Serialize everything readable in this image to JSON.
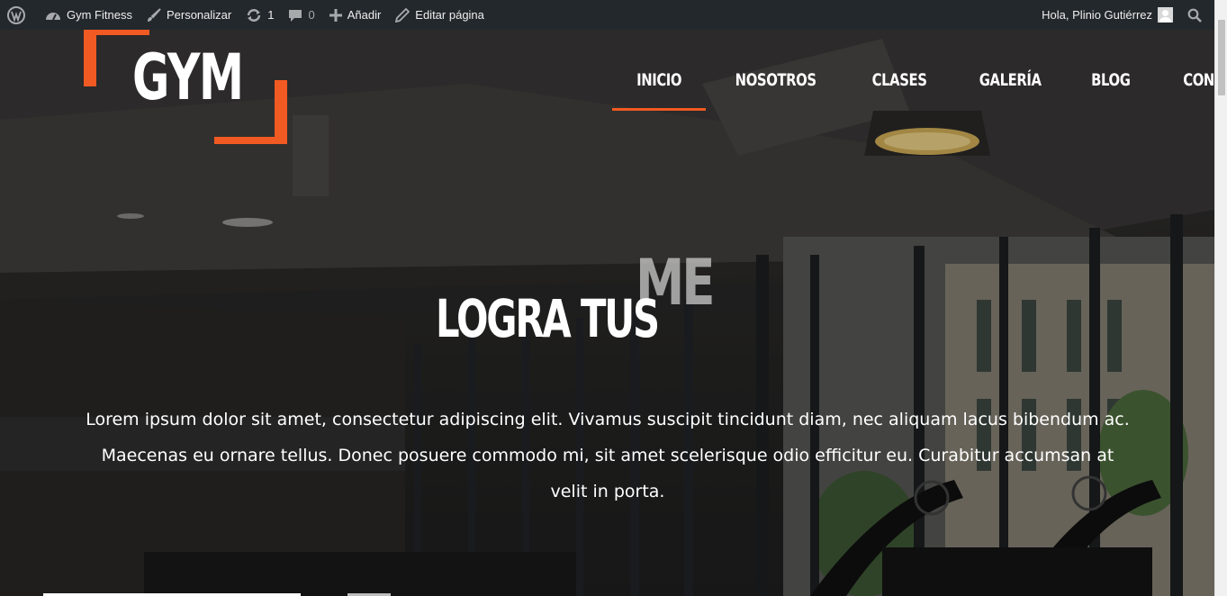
{
  "adminbar": {
    "site_name": "Gym Fitness",
    "customize": "Personalizar",
    "updates_count": "1",
    "comments_count": "0",
    "add_new": "Añadir",
    "edit_page": "Editar página",
    "greeting": "Hola, Plinio Gutiérrez"
  },
  "logo": {
    "text": "GYM",
    "accent_color": "#f15a22"
  },
  "nav": {
    "items": [
      {
        "label": "INICIO",
        "active": true
      },
      {
        "label": "NOSOTROS",
        "active": false
      },
      {
        "label": "CLASES",
        "active": false
      },
      {
        "label": "GALERÍA",
        "active": false
      },
      {
        "label": "BLOG",
        "active": false
      },
      {
        "label": "CONTACTO",
        "active": false
      }
    ]
  },
  "hero": {
    "headline": "LOGRA TUS",
    "headline_ghost": "ME",
    "lead": "Lorem ipsum dolor sit amet, consectetur adipiscing elit. Vivamus suscipit tincidunt diam, nec aliquam lacus bibendum ac. Maecenas eu ornare tellus. Donec posuere commodo mi, sit amet scelerisque odio efficitur eu. Curabitur accumsan at velit in porta."
  }
}
